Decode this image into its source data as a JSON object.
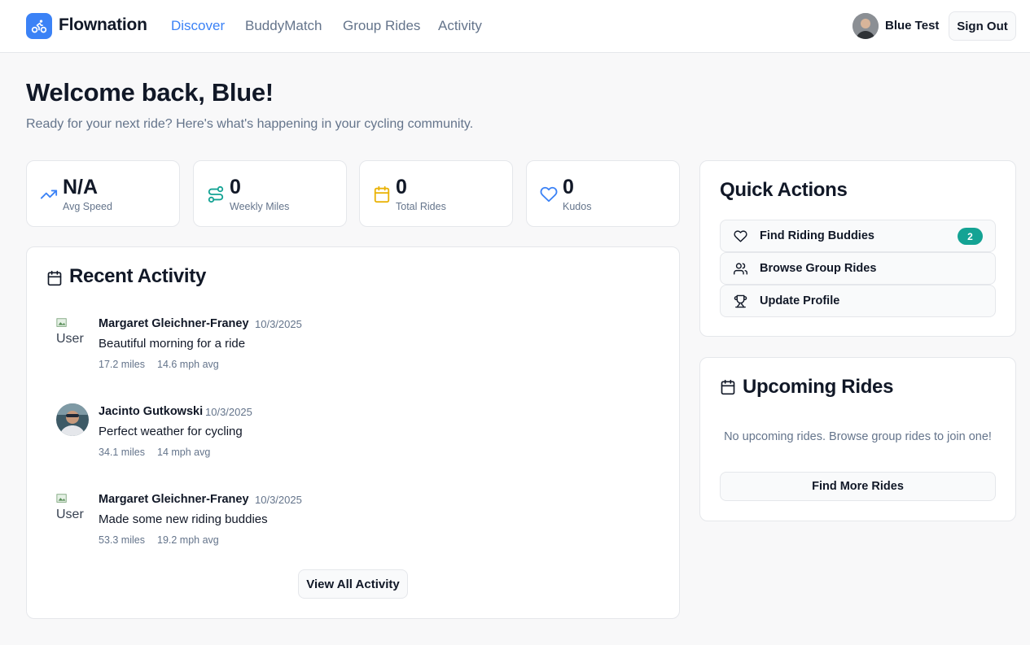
{
  "colors": {
    "accent": "#3b82f6",
    "teal": "#14a394",
    "amber": "#eab308",
    "muted": "#64748b"
  },
  "header": {
    "brand": "Flownation",
    "logo_icon": "bicycle-icon",
    "nav": [
      {
        "label": "Discover",
        "active": true
      },
      {
        "label": "BuddyMatch",
        "active": false
      },
      {
        "label": "Group Rides",
        "active": false
      },
      {
        "label": "Activity",
        "active": false
      }
    ],
    "user_name": "Blue Test",
    "sign_out_label": "Sign Out"
  },
  "hero": {
    "title": "Welcome back, Blue!",
    "subtitle": "Ready for your next ride? Here's what's happening in your cycling community."
  },
  "stats": [
    {
      "value": "N/A",
      "label": "Avg Speed",
      "icon": "trending-up-icon"
    },
    {
      "value": "0",
      "label": "Weekly Miles",
      "icon": "route-icon"
    },
    {
      "value": "0",
      "label": "Total Rides",
      "icon": "calendar-icon"
    },
    {
      "value": "0",
      "label": "Kudos",
      "icon": "heart-icon"
    }
  ],
  "recent_activity": {
    "title": "Recent Activity",
    "items": [
      {
        "name": "Margaret Gleichner-Franey",
        "date": "10/3/2025",
        "text": "Beautiful morning for a ride",
        "miles": "17.2 miles",
        "speed": "14.6 mph avg",
        "avatar_alt": "User",
        "broken_avatar": true
      },
      {
        "name": "Jacinto Gutkowski",
        "date": "10/3/2025",
        "text": "Perfect weather for cycling",
        "miles": "34.1 miles",
        "speed": "14 mph avg",
        "avatar_alt": "User",
        "broken_avatar": false
      },
      {
        "name": "Margaret Gleichner-Franey",
        "date": "10/3/2025",
        "text": "Made some new riding buddies",
        "miles": "53.3 miles",
        "speed": "19.2 mph avg",
        "avatar_alt": "User",
        "broken_avatar": true
      }
    ],
    "view_all_label": "View All Activity"
  },
  "quick_actions": {
    "title": "Quick Actions",
    "items": [
      {
        "label": "Find Riding Buddies",
        "icon": "heart-icon",
        "badge": "2"
      },
      {
        "label": "Browse Group Rides",
        "icon": "users-icon",
        "badge": ""
      },
      {
        "label": "Update Profile",
        "icon": "trophy-icon",
        "badge": ""
      }
    ]
  },
  "upcoming_rides": {
    "title": "Upcoming Rides",
    "empty_text": "No upcoming rides. Browse group rides to join one!",
    "find_more_label": "Find More Rides"
  }
}
